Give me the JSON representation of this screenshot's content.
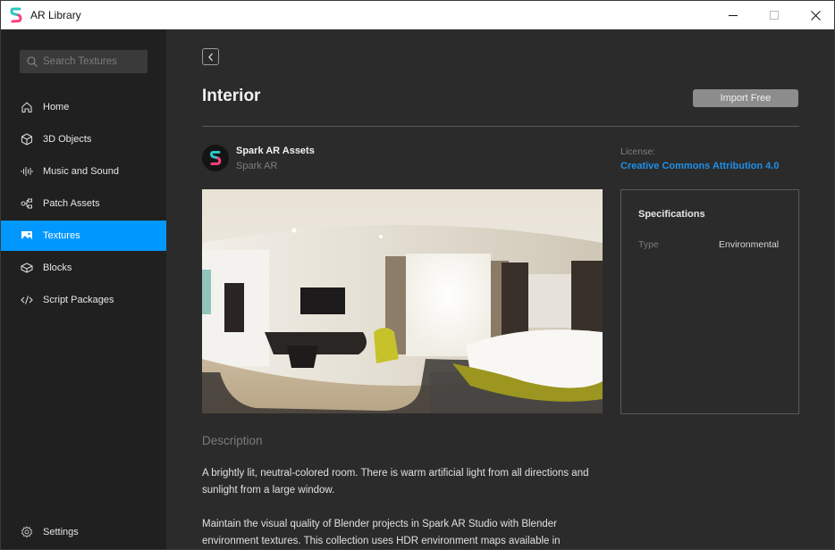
{
  "window": {
    "title": "AR Library",
    "controls": {
      "minimize": "minimize",
      "maximize": "maximize",
      "close": "close"
    }
  },
  "sidebar": {
    "search": {
      "placeholder": "Search Textures",
      "value": ""
    },
    "items": [
      {
        "label": "Home",
        "icon": "home-icon",
        "active": false
      },
      {
        "label": "3D Objects",
        "icon": "cube-icon",
        "active": false
      },
      {
        "label": "Music and Sound",
        "icon": "waveform-icon",
        "active": false
      },
      {
        "label": "Patch Assets",
        "icon": "patch-icon",
        "active": false
      },
      {
        "label": "Textures",
        "icon": "image-icon",
        "active": true
      },
      {
        "label": "Blocks",
        "icon": "block-icon",
        "active": false
      },
      {
        "label": "Script Packages",
        "icon": "code-icon",
        "active": false
      }
    ],
    "settings_label": "Settings",
    "accent": "#0098ff"
  },
  "main": {
    "title": "Interior",
    "import_label": "Import Free",
    "author": {
      "name": "Spark AR Assets",
      "sub": "Spark AR"
    },
    "license": {
      "label": "License:",
      "value": "Creative Commons Attribution 4.0",
      "color": "#1e90e8"
    },
    "preview_alt": "Panoramic view of a hotel room interior",
    "specifications": {
      "title": "Specifications",
      "rows": [
        {
          "key": "Type",
          "value": "Environmental"
        }
      ]
    },
    "description": {
      "title": "Description",
      "paragraphs": [
        "A brightly lit, neutral-colored room. There is warm artificial light from all directions and sunlight from a large window.",
        "Maintain the visual quality of Blender projects in Spark AR Studio with Blender environment textures. This collection uses HDR environment maps available in"
      ]
    }
  }
}
